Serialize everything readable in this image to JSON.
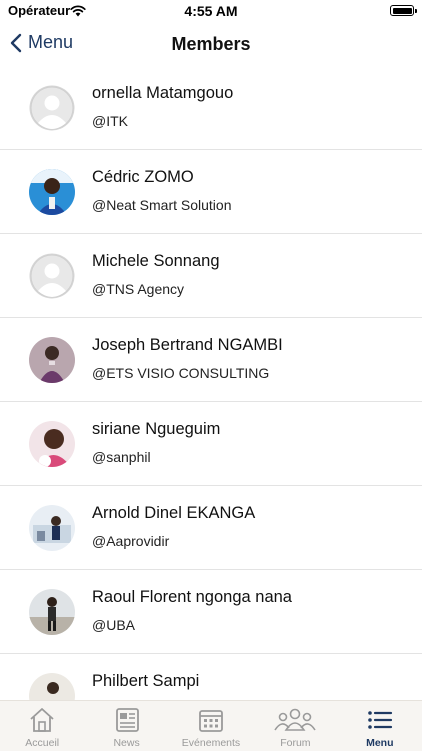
{
  "status_bar": {
    "carrier": "Opérateur",
    "time": "4:55 AM"
  },
  "nav": {
    "back_label": "Menu",
    "title": "Members"
  },
  "members": [
    {
      "name": "ornella Matamgouo",
      "org": "@ITK",
      "avatar": "placeholder"
    },
    {
      "name": "Cédric ZOMO",
      "org": "@Neat Smart Solution",
      "avatar": "photo"
    },
    {
      "name": "Michele Sonnang",
      "org": "@TNS Agency",
      "avatar": "placeholder"
    },
    {
      "name": "Joseph Bertrand NGAMBI",
      "org": "@ETS VISIO CONSULTING",
      "avatar": "photo"
    },
    {
      "name": "siriane Ngueguim",
      "org": "@sanphil",
      "avatar": "photo"
    },
    {
      "name": "Arnold Dinel EKANGA",
      "org": "@Aaprovidir",
      "avatar": "photo"
    },
    {
      "name": "Raoul Florent ngonga nana",
      "org": "@UBA",
      "avatar": "photo"
    },
    {
      "name": "Philbert Sampi",
      "org": "",
      "avatar": "photo"
    }
  ],
  "tabs": [
    {
      "label": "Accueil",
      "icon": "home-icon",
      "active": false
    },
    {
      "label": "News",
      "icon": "news-icon",
      "active": false
    },
    {
      "label": "Evénements",
      "icon": "calendar-icon",
      "active": false
    },
    {
      "label": "Forum",
      "icon": "group-icon",
      "active": false
    },
    {
      "label": "Menu",
      "icon": "menu-icon",
      "active": true
    }
  ],
  "colors": {
    "accent": "#1f3a63",
    "tab_inactive": "#9a9a9a",
    "separator": "#e3e3e3"
  }
}
